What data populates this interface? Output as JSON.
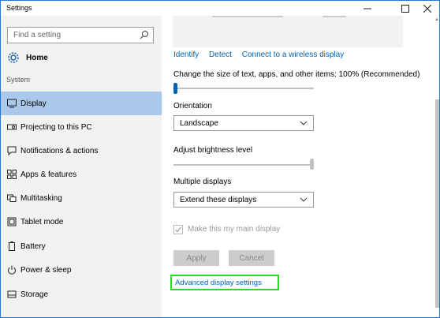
{
  "window": {
    "title": "Settings",
    "minimize_icon": "minimize-icon",
    "maximize_icon": "maximize-icon",
    "close_icon": "close-icon"
  },
  "sidebar": {
    "search": {
      "placeholder": "Find a setting",
      "icon": "search-icon"
    },
    "home": {
      "label": "Home",
      "icon": "gear-icon"
    },
    "section_label": "System",
    "items": [
      {
        "label": "Display",
        "icon": "monitor-icon",
        "active": true
      },
      {
        "label": "Projecting to this PC",
        "icon": "projector-icon",
        "active": false
      },
      {
        "label": "Notifications & actions",
        "icon": "notifications-icon",
        "active": false
      },
      {
        "label": "Apps & features",
        "icon": "apps-icon",
        "active": false
      },
      {
        "label": "Multitasking",
        "icon": "multitasking-icon",
        "active": false
      },
      {
        "label": "Tablet mode",
        "icon": "tablet-icon",
        "active": false
      },
      {
        "label": "Battery",
        "icon": "battery-icon",
        "active": false
      },
      {
        "label": "Power & sleep",
        "icon": "power-icon",
        "active": false
      },
      {
        "label": "Storage",
        "icon": "storage-icon",
        "active": false
      }
    ]
  },
  "main": {
    "links": [
      "Identify",
      "Detect",
      "Connect to a wireless display"
    ],
    "scale_label": "Change the size of text, apps, and other items: 100% (Recommended)",
    "scale_value_percent": 0,
    "orientation": {
      "label": "Orientation",
      "value": "Landscape"
    },
    "brightness": {
      "label": "Adjust brightness level",
      "value_percent": 100
    },
    "multiple_displays": {
      "label": "Multiple displays",
      "value": "Extend these displays"
    },
    "main_display_checkbox": {
      "label": "Make this my main display",
      "checked": true,
      "enabled": false
    },
    "apply_label": "Apply",
    "cancel_label": "Cancel",
    "advanced_link": "Advanced display settings"
  },
  "colors": {
    "accent": "#0063b1",
    "sidebar_bg": "#f2f2f2",
    "active_item_bg": "#aac9ea",
    "highlight_border": "#2bd92b"
  }
}
